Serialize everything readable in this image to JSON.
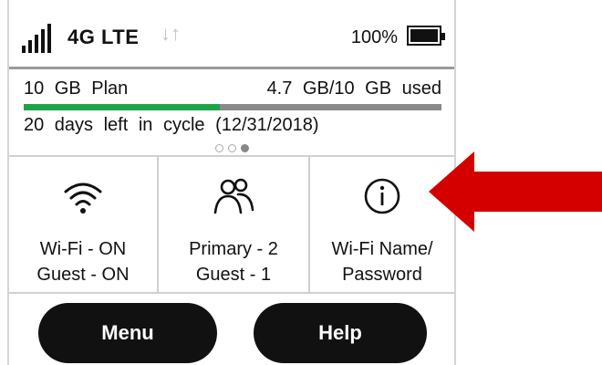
{
  "status": {
    "network": "4G LTE",
    "data_arrows": "↓↑",
    "battery_percent": "100%",
    "battery_level": 1.0
  },
  "plan": {
    "name": "10 GB Plan",
    "used_text": "4.7 GB/10 GB used",
    "used_fraction": 0.47,
    "cycle_text": "20 days left in cycle (12/31/2018)",
    "page_dots": 3,
    "active_dot": 3
  },
  "tiles": [
    {
      "icon": "wifi-icon",
      "line1": "Wi-Fi - ON",
      "line2": "Guest - ON"
    },
    {
      "icon": "people-icon",
      "line1": "Primary - 2",
      "line2": "Guest - 1"
    },
    {
      "icon": "info-icon",
      "line1": "Wi-Fi Name/",
      "line2": "Password"
    }
  ],
  "buttons": {
    "menu": "Menu",
    "help": "Help"
  },
  "colors": {
    "usage_bar": "#1ea34a",
    "annotation_arrow": "#d40000"
  }
}
